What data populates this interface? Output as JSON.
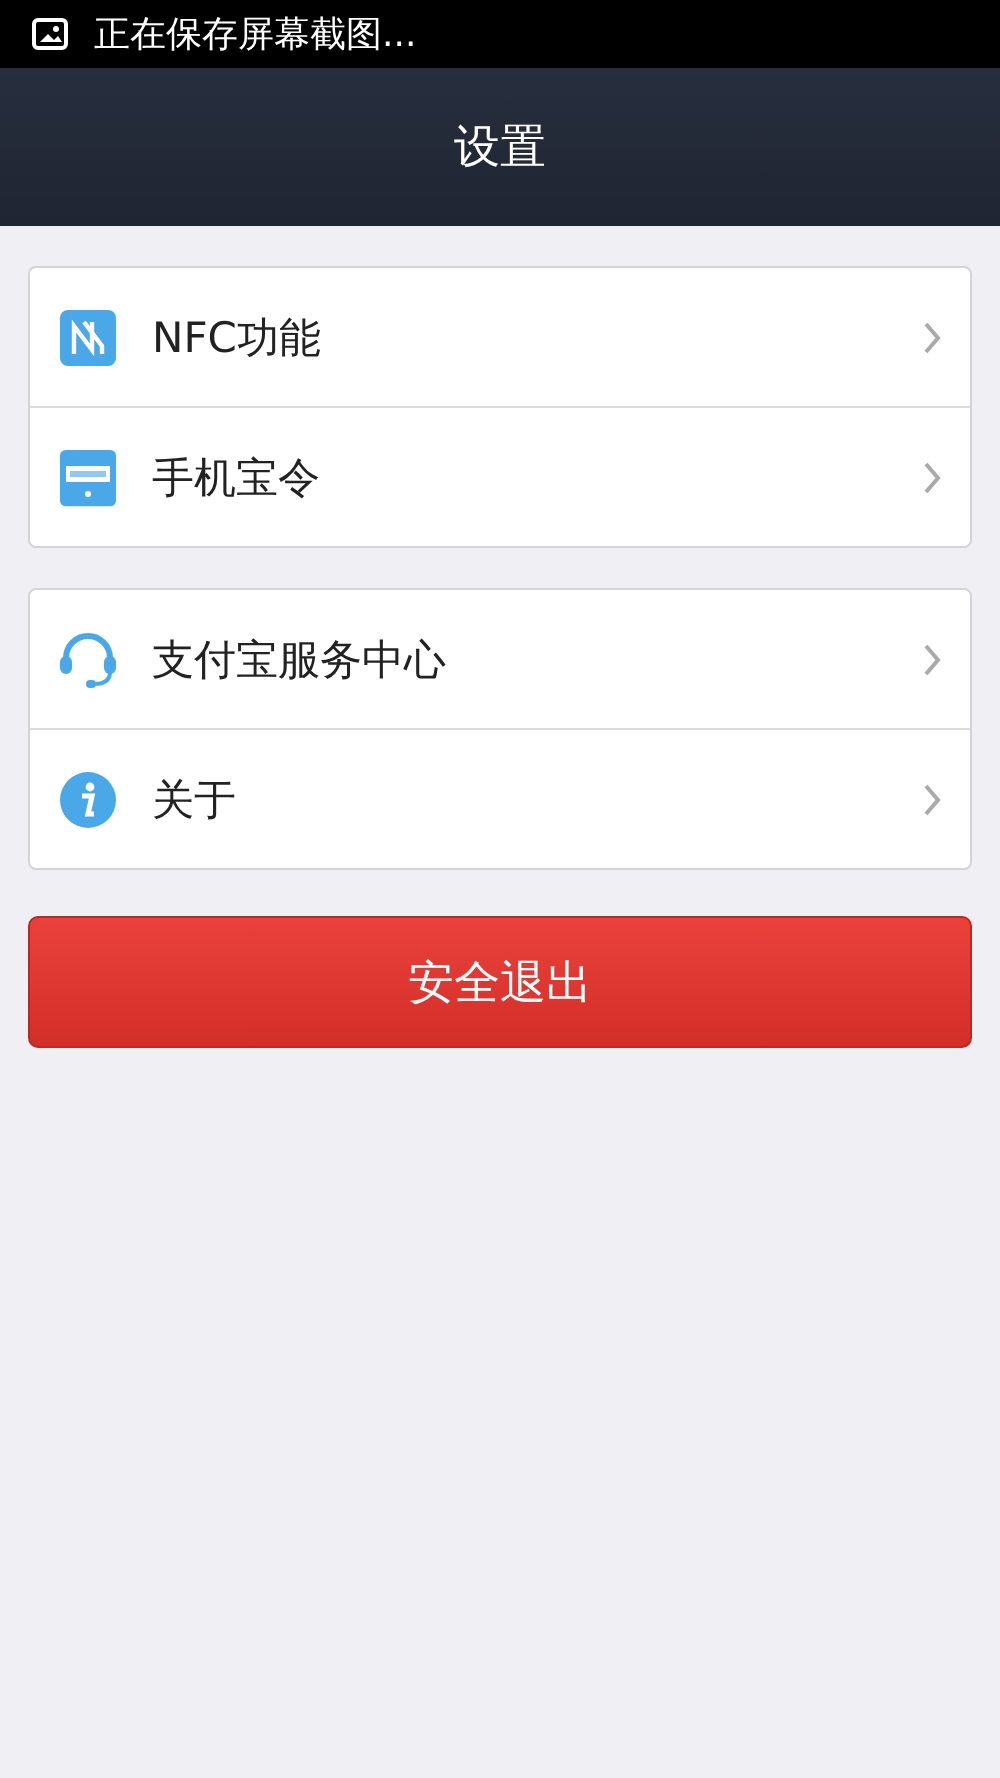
{
  "status_bar": {
    "notification": "正在保存屏幕截图..."
  },
  "header": {
    "title": "设置"
  },
  "groups": [
    {
      "items": [
        {
          "kind": "nfc",
          "label": "NFC功能"
        },
        {
          "kind": "token",
          "label": "手机宝令"
        }
      ]
    },
    {
      "items": [
        {
          "kind": "headset",
          "label": "支付宝服务中心"
        },
        {
          "kind": "info",
          "label": "关于"
        }
      ]
    }
  ],
  "logout_button": "安全退出"
}
